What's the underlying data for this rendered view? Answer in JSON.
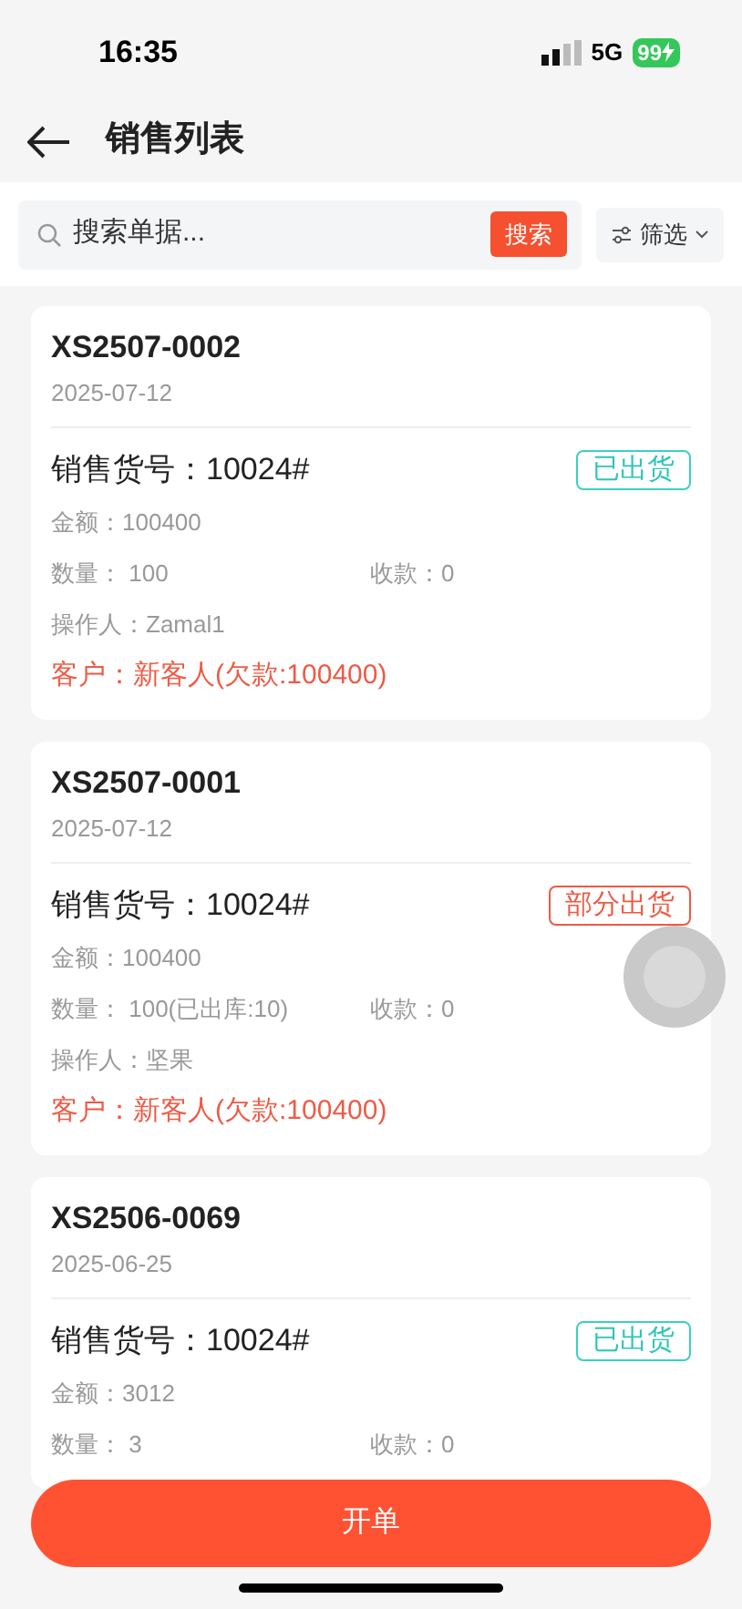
{
  "status_bar": {
    "time": "16:35",
    "network": "5G",
    "battery": "99"
  },
  "header": {
    "title": "销售列表"
  },
  "search": {
    "placeholder": "搜索单据...",
    "button": "搜索",
    "filter": "筛选"
  },
  "orders": [
    {
      "number": "XS2507-0002",
      "date": "2025-07-12",
      "item": "销售货号：10024#",
      "status": {
        "label": "已出货",
        "kind": "shipped"
      },
      "amount": "金额：100400",
      "quantity": "数量：  100",
      "payment": "收款：0",
      "operator": "操作人：Zamal1",
      "customer": "客户：新客人(欠款:100400)"
    },
    {
      "number": "XS2507-0001",
      "date": "2025-07-12",
      "item": "销售货号：10024#",
      "status": {
        "label": "部分出货",
        "kind": "partial"
      },
      "amount": "金额：100400",
      "quantity": "数量：  100(已出库:10)",
      "payment": "收款：0",
      "operator": "操作人：坚果",
      "customer": "客户：新客人(欠款:100400)"
    },
    {
      "number": "XS2506-0069",
      "date": "2025-06-25",
      "item": "销售货号：10024#",
      "status": {
        "label": "已出货",
        "kind": "shipped"
      },
      "amount": "金额：3012",
      "quantity": "数量：  3",
      "payment": "收款：0"
    }
  ],
  "action_button": "开单"
}
